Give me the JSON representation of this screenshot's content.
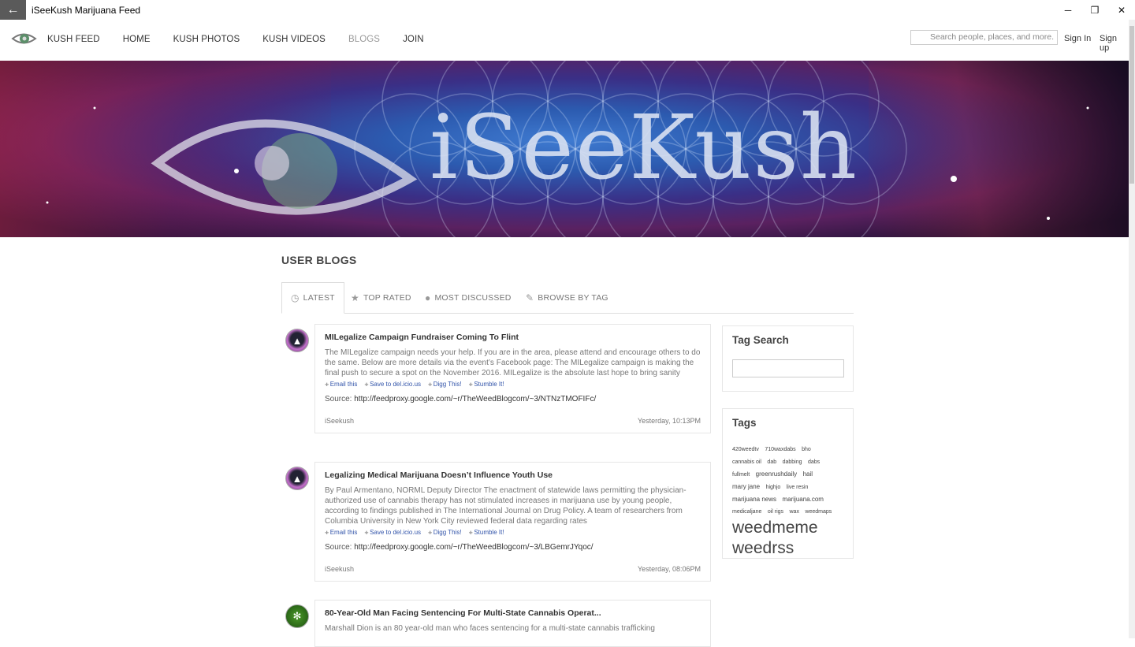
{
  "window": {
    "title": "iSeeKush Marijuana Feed",
    "back_glyph": "←",
    "minimize_glyph": "─",
    "restore_glyph": "❐",
    "close_glyph": "✕"
  },
  "nav": {
    "items": [
      {
        "label": "KUSH FEED"
      },
      {
        "label": "HOME"
      },
      {
        "label": "KUSH PHOTOS"
      },
      {
        "label": "KUSH VIDEOS"
      },
      {
        "label": "BLOGS"
      },
      {
        "label": "JOIN"
      }
    ],
    "search_placeholder": "Search people, places, and more.",
    "sign_in": "Sign In",
    "sign_up": "Sign up"
  },
  "banner": {
    "title": "iSeeKush"
  },
  "main": {
    "section_title": "USER BLOGS",
    "tabs": [
      {
        "label": "LATEST",
        "icon": "clock-icon",
        "glyph": "◷"
      },
      {
        "label": "TOP RATED",
        "icon": "star-icon",
        "glyph": "★"
      },
      {
        "label": "MOST DISCUSSED",
        "icon": "comment-icon",
        "glyph": "●"
      },
      {
        "label": "BROWSE BY TAG",
        "icon": "tag-icon",
        "glyph": "✎"
      }
    ]
  },
  "posts": [
    {
      "title": "MILegalize Campaign Fundraiser Coming To Flint",
      "body": "The MILegalize campaign needs your help. If you are in the area, please attend and encourage others to do the same. Below are more details via the event’s Facebook page: The MILegalize campaign is making the final push to secure a spot on the November 2016. MILegalize is the absolute last hope to bring sanity",
      "share": [
        "Email this",
        "Save to del.icio.us",
        "Digg This!",
        "Stumble It!"
      ],
      "source_label": "Source:",
      "source_url": "http://feedproxy.google.com/~r/TheWeedBlogcom/~3/NTNzTMOFIFc/",
      "author": "iSeekush",
      "time": "Yesterday, 10:13PM"
    },
    {
      "title": "Legalizing Medical Marijuana Doesn’t Influence Youth Use",
      "body": "By Paul Armentano, NORML Deputy Director The enactment of statewide laws permitting the physician-authorized use of cannabis therapy has not stimulated increases in marijuana use by young people, according to findings published in The International Journal on Drug Policy. A team of researchers from Columbia University in New York City reviewed federal data regarding rates",
      "share": [
        "Email this",
        "Save to del.icio.us",
        "Digg This!",
        "Stumble It!"
      ],
      "source_label": "Source:",
      "source_url": "http://feedproxy.google.com/~r/TheWeedBlogcom/~3/LBGemrJYqoc/",
      "author": "iSeekush",
      "time": "Yesterday, 08:06PM"
    },
    {
      "title": "80-Year-Old Man Facing Sentencing For Multi-State Cannabis Operat...",
      "body": "Marshall Dion is an 80 year-old man who faces sentencing for a multi-state cannabis trafficking"
    }
  ],
  "sidebar": {
    "tag_search_title": "Tag Search",
    "tags_title": "Tags",
    "tags_small": [
      "420weedtv",
      "710waxdabs",
      "bho",
      "cannabis oil",
      "dab",
      "dabbing",
      "dabs",
      "fullmelt"
    ],
    "tags_mid": [
      "greenrushdaily",
      "hail",
      "mary jane"
    ],
    "tags_small2": [
      "highjo",
      "live resin"
    ],
    "tags_mid2": [
      "marijuana news",
      "marijuana.com"
    ],
    "tags_small3": [
      "medicaljane",
      "oil rigs",
      "wax",
      "weedmaps"
    ],
    "tags_big": [
      "weedmeme",
      "weedrss"
    ]
  }
}
